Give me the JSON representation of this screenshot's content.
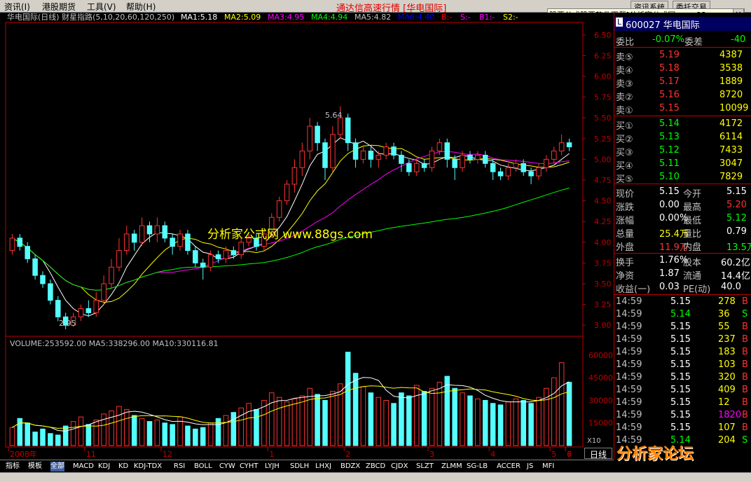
{
  "menu": [
    "资讯(I)",
    "港股期货",
    "工具(V)",
    "帮助(H)"
  ],
  "app_title": "通达信高速行情 [华电国际]",
  "top_buttons": [
    "资讯系统",
    "委托交易"
  ],
  "banner": "股票公式股票软件下载[分析家公式网www.88gs.com]",
  "close_label": "×",
  "chart_header": {
    "name": "华电国际(日线) 财星指路(5,10,20,60,120,250)",
    "ma": [
      {
        "label": "MA1:5.18",
        "color": "#ffffff"
      },
      {
        "label": "MA2:5.09",
        "color": "#ffff00"
      },
      {
        "label": "MA3:4.95",
        "color": "#ff00ff"
      },
      {
        "label": "MA4:4.94",
        "color": "#00ff00"
      },
      {
        "label": "MA5:4.82",
        "color": "#c0c0c0"
      },
      {
        "label": "MA6:4.40",
        "color": "#0000ff"
      },
      {
        "label": "B:-",
        "color": "#ff0000"
      },
      {
        "label": "S:-",
        "color": "#ff00ff"
      },
      {
        "label": "B1:-",
        "color": "#ff00ff"
      },
      {
        "label": "S2:-",
        "color": "#ffff00"
      }
    ]
  },
  "watermark_center": "分析家公式网 www.88gs.com",
  "volume_header": "VOLUME:253592.00 MA5:338296.00 MA10:330116.81",
  "colors": {
    "up": "#ff3232",
    "down": "#54ffff",
    "axis": "#c00000",
    "bg": "#000000"
  },
  "chart_data": {
    "type": "candlestick",
    "price_axis": [
      "6.50",
      "6.25",
      "6.00",
      "5.75",
      "5.50",
      "5.25",
      "5.00",
      "4.75",
      "4.50",
      "4.25",
      "4.00",
      "3.75",
      "3.50",
      "3.25",
      "3.00"
    ],
    "ylim": [
      2.9,
      6.6
    ],
    "high_label": "5.64",
    "low_label": "2.95",
    "x_ticks": [
      "2008年",
      "11",
      "12",
      "1",
      "2",
      "3",
      "4",
      "5",
      "6",
      "7"
    ],
    "volume_axis": [
      "60000",
      "45000",
      "30000",
      "15000"
    ],
    "volume_unit": "X10",
    "candles": [
      [
        3.9,
        4.05,
        4.1,
        3.85
      ],
      [
        4.05,
        3.95,
        4.1,
        3.9
      ],
      [
        3.95,
        3.8,
        4.0,
        3.75
      ],
      [
        3.8,
        3.6,
        3.85,
        3.55
      ],
      [
        3.6,
        3.5,
        3.65,
        3.45
      ],
      [
        3.5,
        3.3,
        3.55,
        3.25
      ],
      [
        3.3,
        3.1,
        3.35,
        3.05
      ],
      [
        3.1,
        3.0,
        3.15,
        2.95
      ],
      [
        3.0,
        3.1,
        3.15,
        2.98
      ],
      [
        3.1,
        3.2,
        3.25,
        3.05
      ],
      [
        3.2,
        3.15,
        3.3,
        3.1
      ],
      [
        3.15,
        3.3,
        3.4,
        3.1
      ],
      [
        3.3,
        3.5,
        3.6,
        3.25
      ],
      [
        3.5,
        3.7,
        3.8,
        3.45
      ],
      [
        3.7,
        3.9,
        4.05,
        3.65
      ],
      [
        3.9,
        4.1,
        4.2,
        3.85
      ],
      [
        4.1,
        4.0,
        4.15,
        3.9
      ],
      [
        4.0,
        4.2,
        4.3,
        3.95
      ],
      [
        4.2,
        4.1,
        4.25,
        4.0
      ],
      [
        4.1,
        4.2,
        4.3,
        4.0
      ],
      [
        4.2,
        4.05,
        4.25,
        4.0
      ],
      [
        4.05,
        3.95,
        4.1,
        3.85
      ],
      [
        3.95,
        4.1,
        4.15,
        3.9
      ],
      [
        4.1,
        3.9,
        4.15,
        3.85
      ],
      [
        3.9,
        3.75,
        3.95,
        3.7
      ],
      [
        3.75,
        3.7,
        3.8,
        3.55
      ],
      [
        3.7,
        3.85,
        3.9,
        3.65
      ],
      [
        3.85,
        3.8,
        3.9,
        3.75
      ],
      [
        3.8,
        3.9,
        3.95,
        3.75
      ],
      [
        3.9,
        3.85,
        3.95,
        3.8
      ],
      [
        3.85,
        4.0,
        4.05,
        3.8
      ],
      [
        4.0,
        4.05,
        4.1,
        3.95
      ],
      [
        4.05,
        3.95,
        4.1,
        3.9
      ],
      [
        3.95,
        4.1,
        4.15,
        3.9
      ],
      [
        4.1,
        4.3,
        4.35,
        4.05
      ],
      [
        4.3,
        4.5,
        4.55,
        4.25
      ],
      [
        4.5,
        4.7,
        4.75,
        4.45
      ],
      [
        4.7,
        4.9,
        5.0,
        4.6
      ],
      [
        4.9,
        5.1,
        5.2,
        4.8
      ],
      [
        5.1,
        5.4,
        5.5,
        5.0
      ],
      [
        5.4,
        5.2,
        5.45,
        5.1
      ],
      [
        5.2,
        4.9,
        5.25,
        4.75
      ],
      [
        4.9,
        5.3,
        5.4,
        4.85
      ],
      [
        5.3,
        5.5,
        5.64,
        5.25
      ],
      [
        5.5,
        5.2,
        5.55,
        5.1
      ],
      [
        5.2,
        5.0,
        5.25,
        4.9
      ],
      [
        5.0,
        5.1,
        5.15,
        4.95
      ],
      [
        5.1,
        5.0,
        5.15,
        4.9
      ],
      [
        5.0,
        5.05,
        5.1,
        4.9
      ],
      [
        5.05,
        5.15,
        5.2,
        5.0
      ],
      [
        5.15,
        5.05,
        5.2,
        5.0
      ],
      [
        5.05,
        4.95,
        5.1,
        4.85
      ],
      [
        4.95,
        4.85,
        5.0,
        4.8
      ],
      [
        4.85,
        4.95,
        5.0,
        4.8
      ],
      [
        4.95,
        4.9,
        5.0,
        4.85
      ],
      [
        4.9,
        5.1,
        5.15,
        4.85
      ],
      [
        5.1,
        5.2,
        5.25,
        5.05
      ],
      [
        5.2,
        5.0,
        5.25,
        4.9
      ],
      [
        5.0,
        4.9,
        5.05,
        4.75
      ],
      [
        4.9,
        5.05,
        5.1,
        4.85
      ],
      [
        5.05,
        5.0,
        5.1,
        4.95
      ],
      [
        5.0,
        5.05,
        5.1,
        4.95
      ],
      [
        5.05,
        4.95,
        5.1,
        4.9
      ],
      [
        4.95,
        4.85,
        5.0,
        4.75
      ],
      [
        4.85,
        4.8,
        4.9,
        4.75
      ],
      [
        4.8,
        4.9,
        4.95,
        4.75
      ],
      [
        4.9,
        4.95,
        5.0,
        4.85
      ],
      [
        4.95,
        4.85,
        5.0,
        4.8
      ],
      [
        4.85,
        4.8,
        4.9,
        4.7
      ],
      [
        4.8,
        4.9,
        4.95,
        4.75
      ],
      [
        4.9,
        5.0,
        5.05,
        4.85
      ],
      [
        5.0,
        5.1,
        5.15,
        4.95
      ],
      [
        5.1,
        5.2,
        5.3,
        5.05
      ],
      [
        5.2,
        5.15,
        5.25,
        5.1
      ]
    ],
    "volumes": [
      120,
      180,
      150,
      90,
      110,
      80,
      70,
      130,
      160,
      190,
      140,
      170,
      210,
      230,
      260,
      240,
      200,
      180,
      160,
      170,
      150,
      140,
      190,
      130,
      110,
      120,
      150,
      180,
      200,
      220,
      250,
      280,
      240,
      300,
      350,
      320,
      290,
      310,
      330,
      380,
      340,
      300,
      360,
      410,
      620,
      480,
      390,
      350,
      320,
      300,
      280,
      350,
      330,
      400,
      360,
      380,
      420,
      460,
      380,
      350,
      330,
      310,
      300,
      280,
      270,
      290,
      310,
      300,
      280,
      320,
      380,
      450,
      550,
      420
    ]
  },
  "quote": {
    "title": "600027 华电国际",
    "weibi_label": "委比",
    "weibi": "-0.07%",
    "weicha_label": "委差",
    "weicha": "-40",
    "sell": [
      {
        "label": "卖⑤",
        "price": "5.19",
        "vol": "4387"
      },
      {
        "label": "卖④",
        "price": "5.18",
        "vol": "3538"
      },
      {
        "label": "卖③",
        "price": "5.17",
        "vol": "1889"
      },
      {
        "label": "卖②",
        "price": "5.16",
        "vol": "8720"
      },
      {
        "label": "卖①",
        "price": "5.15",
        "vol": "10099"
      }
    ],
    "buy": [
      {
        "label": "买①",
        "price": "5.14",
        "vol": "4172"
      },
      {
        "label": "买②",
        "price": "5.13",
        "vol": "6114"
      },
      {
        "label": "买③",
        "price": "5.12",
        "vol": "7433"
      },
      {
        "label": "买④",
        "price": "5.11",
        "vol": "3047"
      },
      {
        "label": "买⑤",
        "price": "5.10",
        "vol": "7829"
      }
    ],
    "stats": [
      {
        "l1": "现价",
        "v1": "5.15",
        "c1": "#ffffff",
        "l2": "今开",
        "v2": "5.15",
        "c2": "#ffffff"
      },
      {
        "l1": "涨跌",
        "v1": "0.00",
        "c1": "#ffffff",
        "l2": "最高",
        "v2": "5.20",
        "c2": "#ff3232"
      },
      {
        "l1": "涨幅",
        "v1": "0.00%",
        "c1": "#ffffff",
        "l2": "最低",
        "v2": "5.12",
        "c2": "#00ff00"
      },
      {
        "l1": "总量",
        "v1": "25.4万",
        "c1": "#ffff00",
        "l2": "量比",
        "v2": "0.79",
        "c2": "#ffffff"
      },
      {
        "l1": "外盘",
        "v1": "11.9万",
        "c1": "#ff3232",
        "l2": "内盘",
        "v2": "13.5万",
        "c2": "#00ff00"
      }
    ],
    "stats2": [
      {
        "l1": "换手",
        "v1": "1.76%",
        "l2": "股本",
        "v2": "60.2亿"
      },
      {
        "l1": "净资",
        "v1": "1.87",
        "l2": "流通",
        "v2": "14.4亿"
      },
      {
        "l1": "收益(一)",
        "v1": "0.03",
        "l2": "PE(动)",
        "v2": "40.0"
      }
    ],
    "ticks": [
      {
        "t": "14:59",
        "p": "5.15",
        "pc": "#ffffff",
        "v": "278",
        "vc": "#ffff00",
        "d": "B",
        "dc": "#ff3232"
      },
      {
        "t": "14:59",
        "p": "5.14",
        "pc": "#00ff00",
        "v": "36",
        "vc": "#ffff00",
        "d": "S",
        "dc": "#00ff00"
      },
      {
        "t": "14:59",
        "p": "5.15",
        "pc": "#ffffff",
        "v": "55",
        "vc": "#ffff00",
        "d": "B",
        "dc": "#ff3232"
      },
      {
        "t": "14:59",
        "p": "5.15",
        "pc": "#ffffff",
        "v": "237",
        "vc": "#ffff00",
        "d": "B",
        "dc": "#ff3232"
      },
      {
        "t": "14:59",
        "p": "5.15",
        "pc": "#ffffff",
        "v": "183",
        "vc": "#ffff00",
        "d": "B",
        "dc": "#ff3232"
      },
      {
        "t": "14:59",
        "p": "5.15",
        "pc": "#ffffff",
        "v": "103",
        "vc": "#ffff00",
        "d": "B",
        "dc": "#ff3232"
      },
      {
        "t": "14:59",
        "p": "5.15",
        "pc": "#ffffff",
        "v": "320",
        "vc": "#ffff00",
        "d": "B",
        "dc": "#ff3232"
      },
      {
        "t": "14:59",
        "p": "5.15",
        "pc": "#ffffff",
        "v": "409",
        "vc": "#ffff00",
        "d": "B",
        "dc": "#ff3232"
      },
      {
        "t": "14:59",
        "p": "5.15",
        "pc": "#ffffff",
        "v": "12",
        "vc": "#ffff00",
        "d": "B",
        "dc": "#ff3232"
      },
      {
        "t": "14:59",
        "p": "5.15",
        "pc": "#ffffff",
        "v": "1820",
        "vc": "#ff00ff",
        "d": "B",
        "dc": "#ff3232"
      },
      {
        "t": "14:59",
        "p": "5.15",
        "pc": "#ffffff",
        "v": "107",
        "vc": "#ffff00",
        "d": "B",
        "dc": "#ff3232"
      },
      {
        "t": "14:59",
        "p": "5.14",
        "pc": "#00ff00",
        "v": "204",
        "vc": "#ffff00",
        "d": "S",
        "dc": "#00ff00"
      }
    ]
  },
  "period_label": "日线",
  "tabs": [
    "指标",
    "模板",
    "全部",
    "MACD",
    "KDJ",
    "KD",
    "KDJ-TDX",
    "RSI",
    "BOLL",
    "CYW",
    "CYHT",
    "LYJH",
    "SDLH",
    "LHXJ",
    "BDZX",
    "ZBCD",
    "CJDX",
    "SLZT",
    "ZLMM",
    "SG-LB",
    "ACCER",
    "JS",
    "MFI"
  ],
  "forum_watermark": "分析家论坛"
}
